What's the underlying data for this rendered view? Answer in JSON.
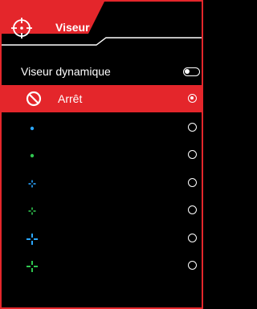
{
  "header": {
    "title": "Viseur",
    "icon": "crosshair-target-icon"
  },
  "dynamic": {
    "label": "Viseur dynamique",
    "state": "off"
  },
  "options": [
    {
      "label": "Arrêt",
      "icon": "no-symbol-icon",
      "selected": true
    },
    {
      "label": "",
      "icon": "dot-small-blue-icon",
      "color": "#2aa6ff",
      "selected": false
    },
    {
      "label": "",
      "icon": "dot-small-green-icon",
      "color": "#2fc54f",
      "selected": false
    },
    {
      "label": "",
      "icon": "crosshair-small-blue-icon",
      "color": "#2aa6ff",
      "selected": false
    },
    {
      "label": "",
      "icon": "crosshair-small-green-icon",
      "color": "#2fc54f",
      "selected": false
    },
    {
      "label": "",
      "icon": "crosshair-large-blue-icon",
      "color": "#2aa6ff",
      "selected": false
    },
    {
      "label": "",
      "icon": "crosshair-large-green-icon",
      "color": "#2fc54f",
      "selected": false
    }
  ],
  "colors": {
    "accent": "#e4262b",
    "background": "#000000"
  }
}
